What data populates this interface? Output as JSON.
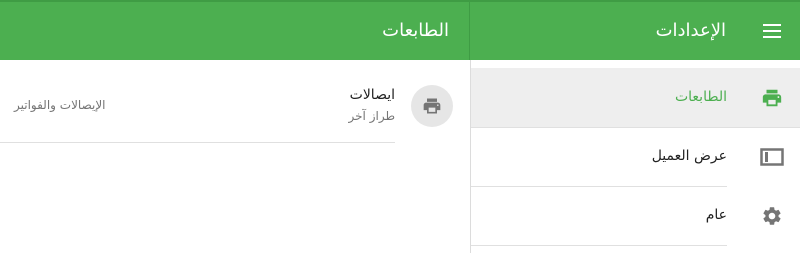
{
  "header": {
    "main_title": "الإعدادات",
    "detail_title": "الطابعات"
  },
  "sidebar": {
    "items": [
      {
        "label": "الطابعات",
        "icon": "printer-icon",
        "active": true
      },
      {
        "label": "عرض العميل",
        "icon": "display-icon",
        "active": false
      },
      {
        "label": "عام",
        "icon": "gear-icon",
        "active": false
      }
    ]
  },
  "printers": [
    {
      "title": "ايصالات",
      "subtitle": "طراز آخر",
      "meta": "الإيصالات والفواتير",
      "icon": "printer-icon"
    }
  ],
  "colors": {
    "accent": "#4caf50",
    "accent_dark": "#3f9c44",
    "icon": "#757575"
  }
}
